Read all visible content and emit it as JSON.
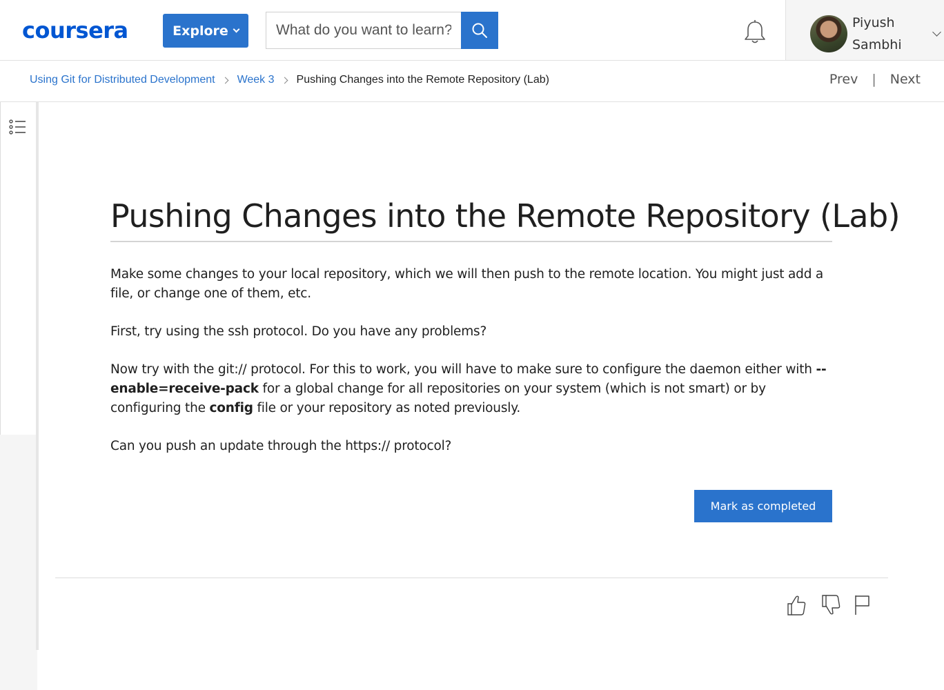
{
  "header": {
    "logo_text": "coursera",
    "explore_label": "Explore",
    "search": {
      "placeholder": "What do you want to learn?",
      "value": ""
    },
    "user": {
      "first_name": "Piyush",
      "last_name": "Sambhi"
    }
  },
  "breadcrumb": {
    "items": [
      "Using Git for Distributed Development",
      "Week 3"
    ],
    "current": "Pushing Changes into the Remote Repository (Lab)"
  },
  "nav": {
    "prev_label": "Prev",
    "separator": "|",
    "next_label": "Next"
  },
  "main": {
    "title": "Pushing Changes into the Remote Repository (Lab)",
    "p1": "Make some changes to your local repository, which we will then push to the remote location. You might just add a file, or change one of them, etc.",
    "p2": "First, try using the ssh protocol. Do you have any problems?",
    "p3": {
      "part1": "Now try with the git:// protocol. For this to work, you will have to make sure to configure the daemon either with ",
      "bold1": "--enable=receive-pack",
      "part2": " for a global change for all repositories on your system (which is not smart) or by configuring the ",
      "bold2": "config",
      "part3": " file or your repository as noted previously."
    },
    "p4": "Can you push an update through the https:// protocol?",
    "complete_button": "Mark as completed"
  },
  "colors": {
    "accent": "#2a73cc",
    "brand": "#0056d2",
    "text": "#1f1f1f"
  },
  "icons": [
    "chevron-down-icon",
    "search-icon",
    "bell-icon",
    "table-of-contents-icon",
    "thumbs-up-icon",
    "thumbs-down-icon",
    "flag-icon"
  ]
}
